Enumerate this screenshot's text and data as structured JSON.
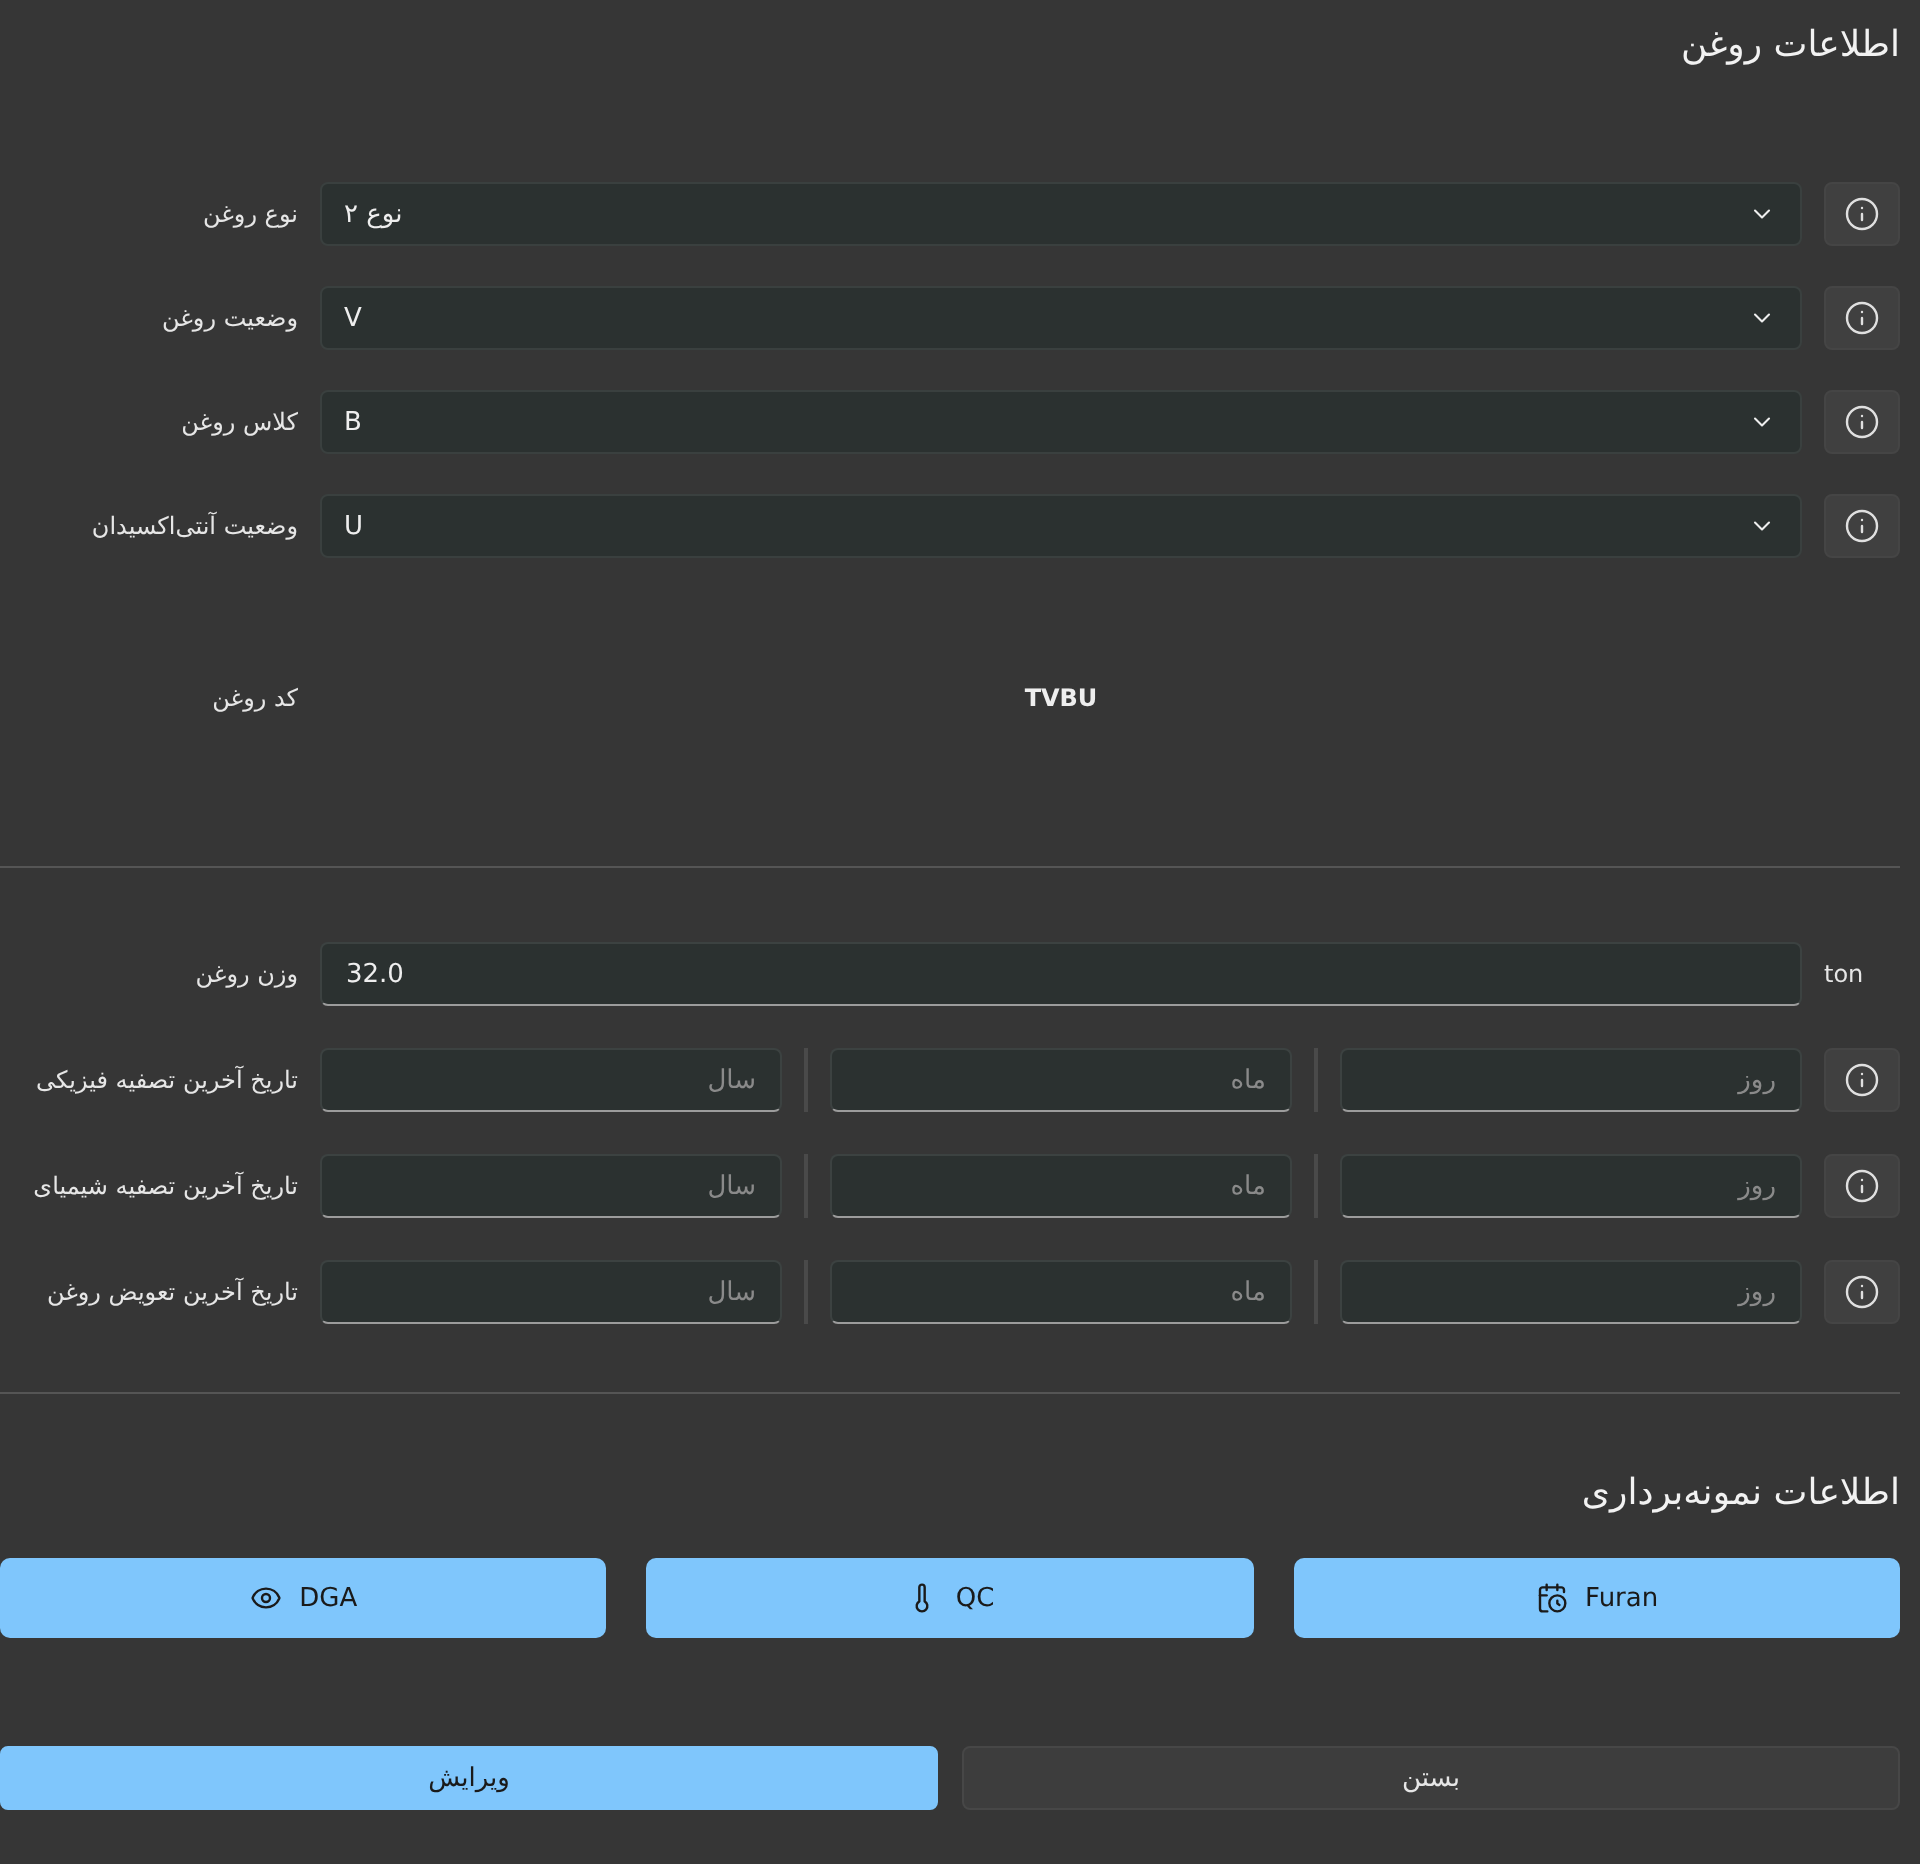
{
  "oil_info": {
    "title": "اطلاعات روغن",
    "selects": [
      {
        "label": "نوع روغن",
        "value": "نوع ۲"
      },
      {
        "label": "وضعیت روغن",
        "value": "V"
      },
      {
        "label": "کلاس روغن",
        "value": "B"
      },
      {
        "label": "وضعیت آنتی‌اکسیدان",
        "value": "U"
      }
    ],
    "code": {
      "label": "کد روغن",
      "value": "TVBU"
    }
  },
  "oil_weight": {
    "label": "وزن روغن",
    "value": "32.0",
    "unit": "ton"
  },
  "dates": [
    {
      "label": "تاریخ آخرین تصفیه فیزیکی",
      "fields": [
        {
          "placeholder": "روز"
        },
        {
          "placeholder": "ماه"
        },
        {
          "placeholder": "سال"
        }
      ]
    },
    {
      "label": "تاریخ آخرین تصفیه شیمیای",
      "fields": [
        {
          "placeholder": "روز"
        },
        {
          "placeholder": "ماه"
        },
        {
          "placeholder": "سال"
        }
      ]
    },
    {
      "label": "تاریخ آخرین تعویض روغن",
      "fields": [
        {
          "placeholder": "روز"
        },
        {
          "placeholder": "ماه"
        },
        {
          "placeholder": "سال"
        }
      ]
    }
  ],
  "sampling": {
    "title": "اطلاعات نمونه‌برداری",
    "buttons": [
      {
        "label": "Furan"
      },
      {
        "label": "QC"
      },
      {
        "label": "DGA"
      }
    ]
  },
  "actions": [
    {
      "label": "بستن",
      "kind": "secondary"
    },
    {
      "label": "ویرایش",
      "kind": "primary"
    }
  ]
}
